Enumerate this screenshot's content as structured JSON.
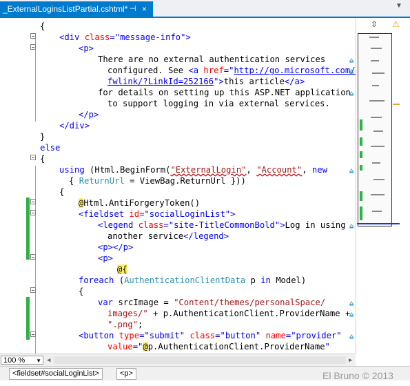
{
  "tab": {
    "title": "_ExternalLoginsListPartial.cshtml*",
    "pin": "⊣",
    "close": "×"
  },
  "tab_dropdown": "▼",
  "code": [
    {
      "parts": [
        {
          "t": "{",
          "c": ""
        }
      ]
    },
    {
      "parts": [
        {
          "t": "<",
          "c": "tg"
        },
        {
          "t": "div",
          "c": "tg"
        },
        {
          "t": " class",
          "c": "an"
        },
        {
          "t": "=",
          "c": "tg"
        },
        {
          "t": "\"message-info\"",
          "c": "av"
        },
        {
          "t": ">",
          "c": "tg"
        }
      ]
    },
    {
      "parts": [
        {
          "t": "<p>",
          "c": "tg"
        }
      ]
    },
    {
      "parts": [
        {
          "t": "There are no external authentication services",
          "c": ""
        }
      ]
    },
    {
      "parts": [
        {
          "t": "configured. See ",
          "c": ""
        },
        {
          "t": "<a",
          "c": "tg"
        },
        {
          "t": " href",
          "c": "an"
        },
        {
          "t": "=\"",
          "c": "tg"
        },
        {
          "t": "http://go.microsoft.com/",
          "c": "lnk"
        }
      ]
    },
    {
      "parts": [
        {
          "t": "fwlink/?LinkId=252166",
          "c": "lnk"
        },
        {
          "t": "\">",
          "c": "tg"
        },
        {
          "t": "this article",
          "c": ""
        },
        {
          "t": "</a>",
          "c": "tg"
        }
      ]
    },
    {
      "parts": [
        {
          "t": "for details on setting up this ASP.NET application",
          "c": ""
        }
      ]
    },
    {
      "parts": [
        {
          "t": "to support logging in via external services.",
          "c": ""
        }
      ]
    },
    {
      "parts": [
        {
          "t": "</p>",
          "c": "tg"
        }
      ]
    },
    {
      "parts": [
        {
          "t": "</div>",
          "c": "tg"
        }
      ]
    },
    {
      "parts": [
        {
          "t": "}",
          "c": ""
        }
      ]
    },
    {
      "parts": [
        {
          "t": "else",
          "c": "kw"
        }
      ]
    },
    {
      "parts": [
        {
          "t": "{",
          "c": ""
        }
      ]
    },
    {
      "parts": [
        {
          "t": "using",
          "c": "kw"
        },
        {
          "t": " (Html.BeginForm(",
          "c": ""
        },
        {
          "t": "\"ExternalLogin\"",
          "c": "red"
        },
        {
          "t": ", ",
          "c": ""
        },
        {
          "t": "\"Account\"",
          "c": "red"
        },
        {
          "t": ", ",
          "c": ""
        },
        {
          "t": "new",
          "c": "kw"
        }
      ]
    },
    {
      "parts": [
        {
          "t": "{ ",
          "c": ""
        },
        {
          "t": "ReturnUrl",
          "c": "typ"
        },
        {
          "t": " = ViewBag.ReturnUrl }))",
          "c": ""
        }
      ]
    },
    {
      "parts": [
        {
          "t": "{",
          "c": ""
        }
      ]
    },
    {
      "parts": [
        {
          "t": "@",
          "c": "hl"
        },
        {
          "t": "Html.AntiForgeryToken()",
          "c": ""
        }
      ]
    },
    {
      "parts": [
        {
          "t": "<fieldset",
          "c": "tg"
        },
        {
          "t": " id",
          "c": "an"
        },
        {
          "t": "=",
          "c": "tg"
        },
        {
          "t": "\"socialLoginList\"",
          "c": "av"
        },
        {
          "t": ">",
          "c": "tg"
        }
      ]
    },
    {
      "parts": [
        {
          "t": "<legend",
          "c": "tg"
        },
        {
          "t": " class",
          "c": "an"
        },
        {
          "t": "=",
          "c": "tg"
        },
        {
          "t": "\"site-TitleCommonBold\"",
          "c": "av"
        },
        {
          "t": ">",
          "c": "tg"
        },
        {
          "t": "Log in using",
          "c": ""
        }
      ]
    },
    {
      "parts": [
        {
          "t": "another service",
          "c": ""
        },
        {
          "t": "</legend>",
          "c": "tg"
        }
      ]
    },
    {
      "parts": [
        {
          "t": "<p></p>",
          "c": "tg"
        }
      ]
    },
    {
      "parts": [
        {
          "t": "<p>",
          "c": "tg"
        }
      ]
    },
    {
      "parts": [
        {
          "t": "@{",
          "c": "hl"
        }
      ]
    },
    {
      "parts": [
        {
          "t": "foreach",
          "c": "kw"
        },
        {
          "t": " (",
          "c": ""
        },
        {
          "t": "AuthenticationClientData",
          "c": "typ"
        },
        {
          "t": " p ",
          "c": ""
        },
        {
          "t": "in",
          "c": "kw"
        },
        {
          "t": " Model)",
          "c": ""
        }
      ]
    },
    {
      "parts": [
        {
          "t": "{",
          "c": ""
        }
      ]
    },
    {
      "parts": [
        {
          "t": "var",
          "c": "kw"
        },
        {
          "t": " srcImage = ",
          "c": ""
        },
        {
          "t": "\"Content/themes/personalSpace/",
          "c": "str"
        }
      ]
    },
    {
      "parts": [
        {
          "t": "images/\"",
          "c": "str"
        },
        {
          "t": " + p.AuthenticationClient.ProviderName +",
          "c": ""
        }
      ]
    },
    {
      "parts": [
        {
          "t": "\".png\"",
          "c": "str"
        },
        {
          "t": ";",
          "c": ""
        }
      ]
    },
    {
      "parts": [
        {
          "t": "<button",
          "c": "tg"
        },
        {
          "t": " type",
          "c": "an"
        },
        {
          "t": "=",
          "c": "tg"
        },
        {
          "t": "\"submit\"",
          "c": "av"
        },
        {
          "t": " class",
          "c": "an"
        },
        {
          "t": "=",
          "c": "tg"
        },
        {
          "t": "\"button\"",
          "c": "av"
        },
        {
          "t": " name",
          "c": "an"
        },
        {
          "t": "=",
          "c": "tg"
        },
        {
          "t": "\"provider\"",
          "c": "av"
        }
      ]
    },
    {
      "parts": [
        {
          "t": "value",
          "c": "an"
        },
        {
          "t": "=\"",
          "c": "tg"
        },
        {
          "t": "@",
          "c": "hl"
        },
        {
          "t": "p.AuthenticationClient.ProviderName",
          "c": ""
        },
        {
          "t": "\"",
          "c": "tg"
        }
      ]
    }
  ],
  "zoom": "100 %",
  "breadcrumb": [
    "<fieldset#socialLoginList>",
    "<p>"
  ],
  "watermark": "El Bruno © 2013",
  "icons": {
    "splitter": "splitter-icon",
    "warning": "warning-icon",
    "comment_marker": "comment-icon"
  },
  "colors": {
    "accent": "#007acc",
    "change_bar": "#2fb144"
  }
}
